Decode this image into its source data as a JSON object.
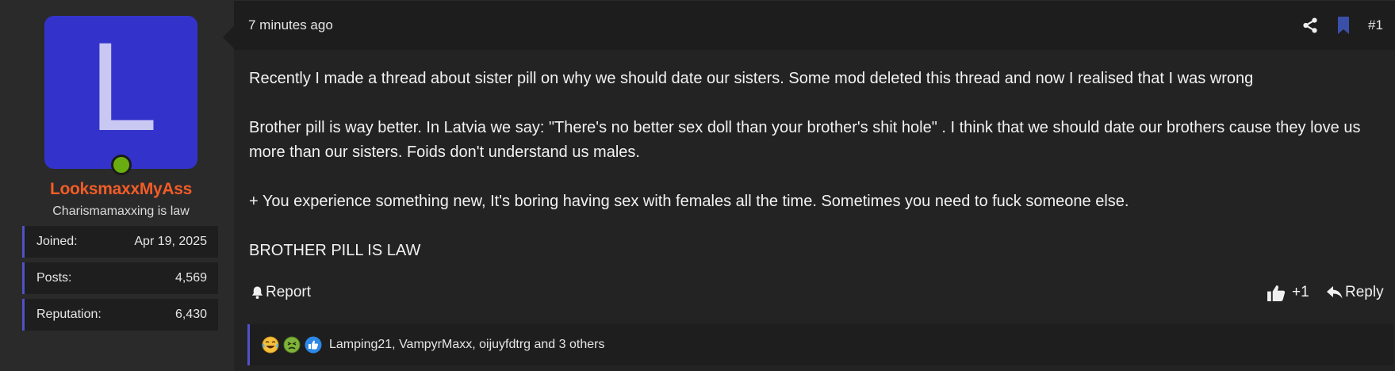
{
  "user": {
    "avatar_letter": "L",
    "avatar_color": "#3333cc",
    "online": true,
    "username": "LooksmaxxMyAss",
    "user_title": "Charismamaxxing is law",
    "stats": [
      {
        "label": "Joined:",
        "value": "Apr 19, 2025"
      },
      {
        "label": "Posts:",
        "value": "4,569"
      },
      {
        "label": "Reputation:",
        "value": "6,430"
      }
    ]
  },
  "post": {
    "timestamp": "7 minutes ago",
    "share_icon": "share-icon",
    "bookmark_icon": "bookmark-icon",
    "number": "#1",
    "paragraphs": [
      "Recently I made a thread about sister pill on why we should date our sisters. Some mod deleted this thread and now I realised that I was wrong",
      "Brother pill is way better. In Latvia we say: \"There's no better sex doll than your brother's shit hole\" . I think that we should date our brothers cause they love us more than our sisters. Foids don't understand us males.",
      "+ You experience something new, It's boring having sex with females all the time. Sometimes you need to fuck someone else.",
      "BROTHER PILL IS LAW"
    ],
    "actions": {
      "report_label": "Report",
      "like_label": "+1",
      "reply_label": "Reply"
    },
    "reactions": {
      "icons": [
        "tears-of-joy-icon",
        "nauseated-face-icon",
        "thumbs-up-icon"
      ],
      "reactors_text": "Lamping21, VampyrMaxx, oijuyfdtrg and 3 others"
    }
  },
  "colors": {
    "username": "#f25c27",
    "accent": "#5151c9",
    "online": "#6aad10",
    "bookmark": "#3a4fa8"
  }
}
